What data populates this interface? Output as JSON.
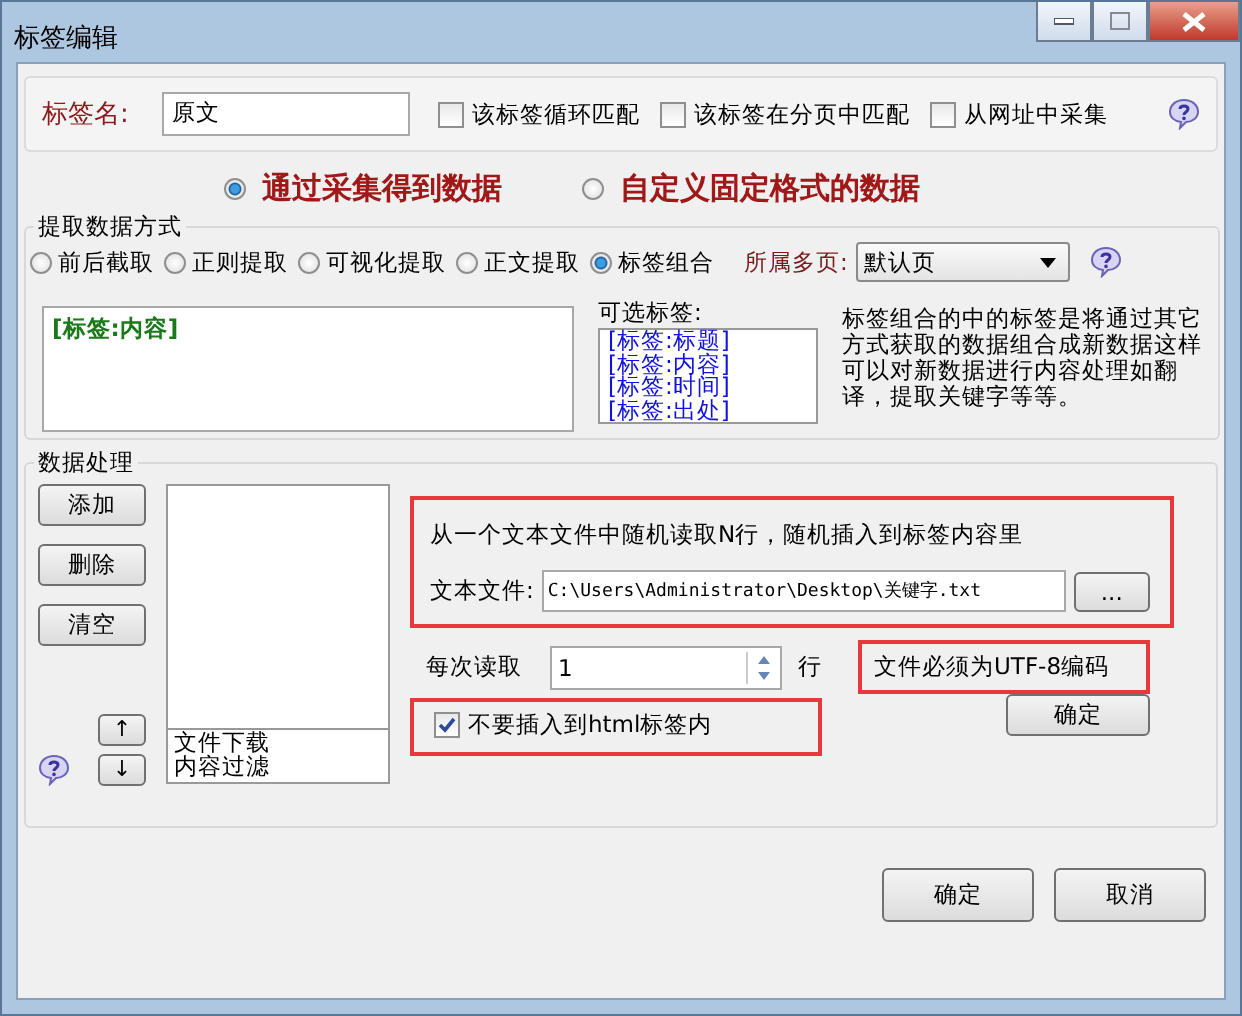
{
  "window": {
    "title": "标签编辑"
  },
  "tag_name": {
    "label": "标签名:",
    "value": "原文"
  },
  "options": [
    {
      "label": "该标签循环匹配",
      "checked": false
    },
    {
      "label": "该标签在分页中匹配",
      "checked": false
    },
    {
      "label": "从网址中采集",
      "checked": false
    }
  ],
  "source_modes": [
    {
      "label": "通过采集得到数据",
      "selected": true
    },
    {
      "label": "自定义固定格式的数据",
      "selected": false
    }
  ],
  "extract": {
    "title": "提取数据方式",
    "methods": [
      {
        "label": "前后截取",
        "selected": false
      },
      {
        "label": "正则提取",
        "selected": false
      },
      {
        "label": "可视化提取",
        "selected": false
      },
      {
        "label": "正文提取",
        "selected": false
      },
      {
        "label": "标签组合",
        "selected": true
      }
    ],
    "page_label": "所属多页:",
    "page_value": "默认页",
    "combo_content": "[标签:内容]",
    "available_label": "可选标签:",
    "available_tags": [
      "[标签:标题]",
      "[标签:内容]",
      "[标签:时间]",
      "[标签:出处]"
    ],
    "description": "标签组合的中的标签是将通过其它方式获取的数据组合成新数据这样可以对新数据进行内容处理如翻译，提取关键字等等。"
  },
  "processing": {
    "title": "数据处理",
    "buttons": [
      "添加",
      "删除",
      "清空"
    ],
    "items": [
      "文件下载",
      "内容过滤"
    ],
    "move_buttons": [
      "↑",
      "↓"
    ],
    "file_block": {
      "highlighted": true,
      "description": "从一个文本文件中随机读取N行，随机插入到标签内容里",
      "file_label": "文本文件:",
      "file_path": "C:\\Users\\Administrator\\Desktop\\关键字.txt",
      "browse": "..."
    },
    "read_label": "每次读取",
    "read_value": "1",
    "read_unit": "行",
    "encoding_note": {
      "text": "文件必须为UTF-8编码",
      "highlighted": true
    },
    "no_html": {
      "label": "不要插入到html标签内",
      "checked": true,
      "highlighted": true
    },
    "confirm": "确定"
  },
  "footer_buttons": [
    "确定",
    "取消"
  ]
}
